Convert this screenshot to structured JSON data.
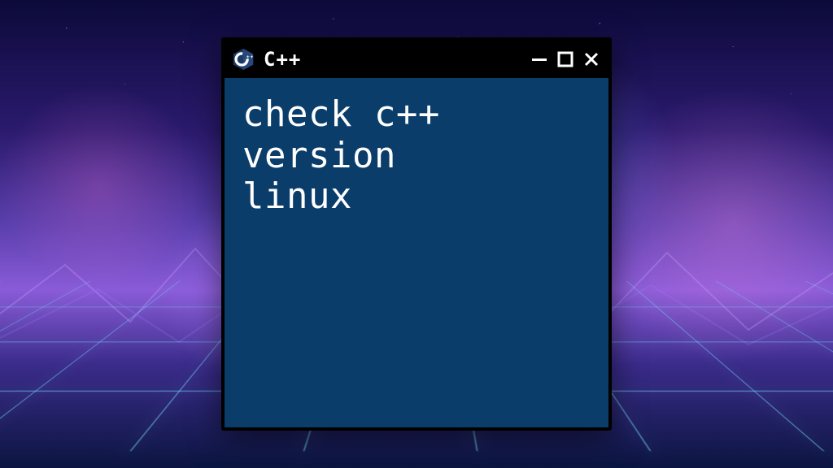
{
  "window": {
    "title": "C++",
    "icon": "cpp-logo-icon",
    "content_text": "check c++\nversion\nlinux",
    "controls": {
      "minimize_label": "Minimize",
      "maximize_label": "Maximize",
      "close_label": "Close"
    }
  },
  "colors": {
    "window_bg": "#0b3d6b",
    "titlebar_bg": "#000000",
    "text": "#ffffff"
  }
}
